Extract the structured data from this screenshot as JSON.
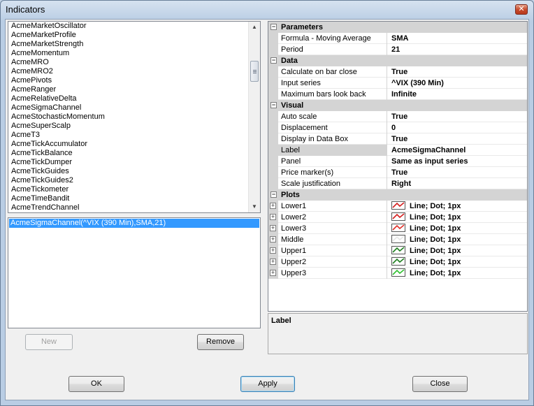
{
  "window": {
    "title": "Indicators",
    "close_glyph": "✕"
  },
  "indicator_list": {
    "items": [
      "AcmeMarketOscillator",
      "AcmeMarketProfile",
      "AcmeMarketStrength",
      "AcmeMomentum",
      "AcmeMRO",
      "AcmeMRO2",
      "AcmePivots",
      "AcmeRanger",
      "AcmeRelativeDelta",
      "AcmeSigmaChannel",
      "AcmeStochasticMomentum",
      "AcmeSuperScalp",
      "AcmeT3",
      "AcmeTickAccumulator",
      "AcmeTickBalance",
      "AcmeTickDumper",
      "AcmeTickGuides",
      "AcmeTickGuides2",
      "AcmeTickometer",
      "AcmeTimeBandit",
      "AcmeTrendChannel"
    ],
    "scroll_up_icon": "▲",
    "scroll_down_icon": "▼"
  },
  "configured": {
    "items": [
      "AcmeSigmaChannel(^VIX (390 Min),SMA,21)"
    ]
  },
  "buttons": {
    "new": "New",
    "remove": "Remove",
    "ok": "OK",
    "apply": "Apply",
    "close": "Close"
  },
  "property_grid": {
    "categories": [
      {
        "name": "Parameters",
        "toggle": "−",
        "rows": [
          {
            "name": "Formula - Moving Average",
            "value": "SMA"
          },
          {
            "name": "Period",
            "value": "21"
          }
        ]
      },
      {
        "name": "Data",
        "toggle": "−",
        "rows": [
          {
            "name": "Calculate on bar close",
            "value": "True"
          },
          {
            "name": "Input series",
            "value": "^VIX (390 Min)"
          },
          {
            "name": "Maximum bars look back",
            "value": "Infinite"
          }
        ]
      },
      {
        "name": "Visual",
        "toggle": "−",
        "rows": [
          {
            "name": "Auto scale",
            "value": "True"
          },
          {
            "name": "Displacement",
            "value": "0"
          },
          {
            "name": "Display in Data Box",
            "value": "True"
          },
          {
            "name": "Label",
            "value": "AcmeSigmaChannel",
            "selected": true
          },
          {
            "name": "Panel",
            "value": "Same as input series"
          },
          {
            "name": "Price marker(s)",
            "value": "True"
          },
          {
            "name": "Scale justification",
            "value": "Right"
          }
        ]
      }
    ],
    "plots": {
      "name": "Plots",
      "toggle": "−",
      "rows": [
        {
          "name": "Lower1",
          "value": "Line; Dot; 1px",
          "color": "#d42020",
          "toggle": "+"
        },
        {
          "name": "Lower2",
          "value": "Line; Dot; 1px",
          "color": "#d42020",
          "toggle": "+"
        },
        {
          "name": "Lower3",
          "value": "Line; Dot; 1px",
          "color": "#e0302a",
          "toggle": "+"
        },
        {
          "name": "Middle",
          "value": "Line; Dot; 1px",
          "color": "#e6e6e6",
          "toggle": "+"
        },
        {
          "name": "Upper1",
          "value": "Line; Dot; 1px",
          "color": "#208020",
          "toggle": "+"
        },
        {
          "name": "Upper2",
          "value": "Line; Dot; 1px",
          "color": "#208020",
          "toggle": "+"
        },
        {
          "name": "Upper3",
          "value": "Line; Dot; 1px",
          "color": "#30c030",
          "toggle": "+"
        }
      ]
    }
  },
  "description": {
    "title": "Label"
  }
}
